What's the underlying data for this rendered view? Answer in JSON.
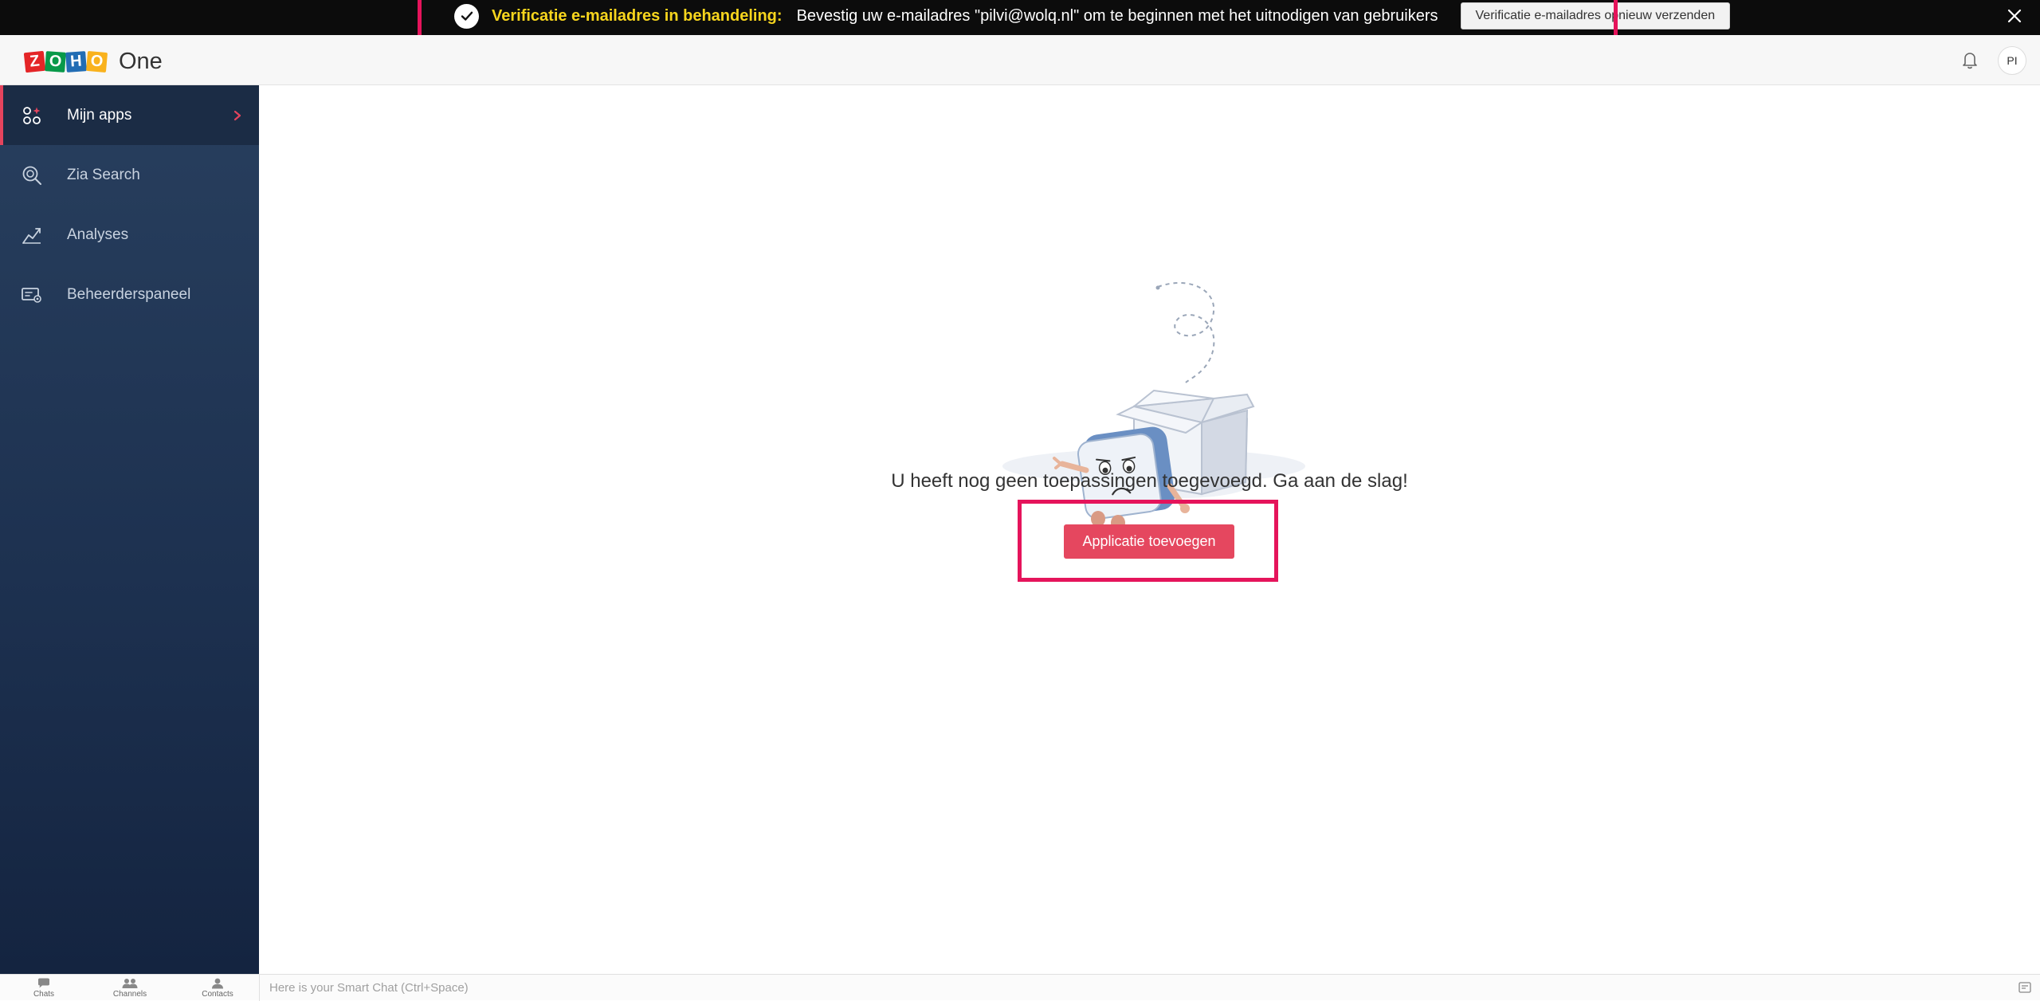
{
  "banner": {
    "title": "Verificatie e-mailadres in behandeling:",
    "message": "Bevestig uw e-mailadres \"pilvi@wolq.nl\" om te beginnen met het uitnodigen van gebruikers",
    "button_label": "Verificatie e-mailadres opnieuw verzenden",
    "title_color": "#f7d51d",
    "highlight_color": "#e5145b"
  },
  "header": {
    "logo_letters": [
      "Z",
      "O",
      "H",
      "O"
    ],
    "logo_colors": [
      "#e42527",
      "#089949",
      "#226db4",
      "#f9b21d"
    ],
    "product_name": "One",
    "avatar_initials": "PI"
  },
  "sidebar": {
    "items": [
      {
        "label": "Mijn apps",
        "icon": "apps-grid-icon",
        "active": true
      },
      {
        "label": "Zia Search",
        "icon": "search-icon",
        "active": false
      },
      {
        "label": "Analyses",
        "icon": "analytics-icon",
        "active": false
      },
      {
        "label": "Beheerderspaneel",
        "icon": "admin-panel-icon",
        "active": false
      }
    ],
    "accent_color": "#e5445d"
  },
  "main": {
    "empty_message": "U heeft nog geen toepassingen toegevoegd. Ga aan de slag!",
    "add_button_label": "Applicatie toevoegen",
    "button_color": "#e5475f"
  },
  "bottom_bar": {
    "tabs": [
      {
        "label": "Chats",
        "icon": "chat-icon"
      },
      {
        "label": "Channels",
        "icon": "channels-icon"
      },
      {
        "label": "Contacts",
        "icon": "contacts-icon"
      }
    ],
    "smart_chat_placeholder": "Here is your Smart Chat (Ctrl+Space)"
  }
}
